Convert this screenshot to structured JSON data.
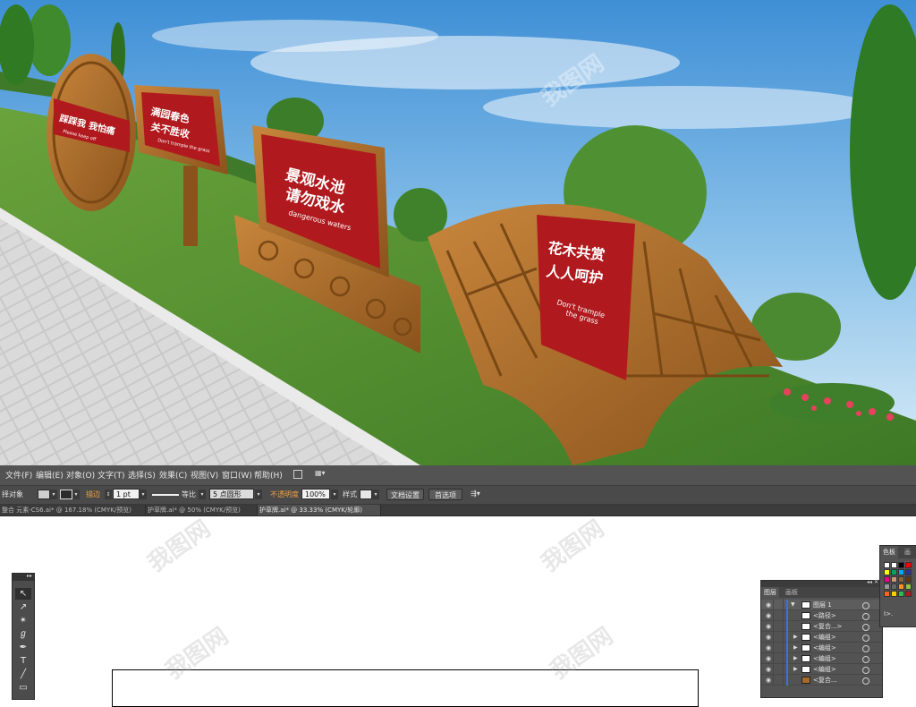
{
  "scene": {
    "sign_flower_top": "花木共赏",
    "sign_flower_bottom": "人人呵护",
    "sign_flower_en1": "Don't trample",
    "sign_flower_en2": "the grass",
    "sign_pool_top": "景观水池",
    "sign_pool_bottom": "请勿戏水",
    "sign_pool_en": "dangerous waters",
    "sign_garden_top": "满园春色",
    "sign_garden_bottom": "关不胜收",
    "sign_garden_en": "Don't trample the grass",
    "sign_round": "踩踩我 我怕痛",
    "sign_round_en": "Please keep off"
  },
  "menubar": {
    "items": [
      "文件(F)",
      "编辑(E)",
      "对象(O)",
      "文字(T)",
      "选择(S)",
      "效果(C)",
      "视图(V)",
      "窗口(W)",
      "帮助(H)"
    ]
  },
  "controlbar": {
    "selection_label": "择对象",
    "stroke_label": "描边",
    "stroke_weight": "1 pt",
    "stroke_profile": "等比",
    "brush": "5 点圆形",
    "opacity_label": "不透明度",
    "opacity_value": "100%",
    "style_label": "样式",
    "doc_setup_button": "文档设置",
    "preferences_button": "首选项"
  },
  "tabs": [
    "整合 元素-CS6.ai* @ 167.18% (CMYK/预览)",
    "护草牌.ai* @ 50% (CMYK/预览)",
    "护草牌.ai* @ 33.33% (CMYK/轮廓)"
  ],
  "watermark": "我图网",
  "layers_panel": {
    "tab_layers": "图层",
    "tab_artboards": "画板",
    "rows": [
      "图层 1",
      "<路径>",
      "<复合...>",
      "<编组>",
      "<编组>",
      "<编组>",
      "<编组>",
      "<复合..."
    ]
  },
  "swatches_panel": {
    "tab_swatches": "色板",
    "tab_other": "画笔",
    "bottom_label": "I>."
  },
  "colors": {
    "sign_red": "#b01a1e",
    "wood": "#a86a2a",
    "sky": "#5aa3dc",
    "grass": "#4e8a2e",
    "ui_dark": "#535353"
  }
}
